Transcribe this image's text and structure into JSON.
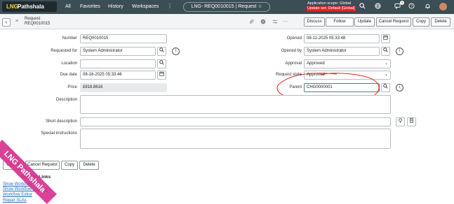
{
  "topnav": {
    "logo_lng": "LNG",
    "logo_text": "Pathshala",
    "links": [
      "All",
      "Favorites",
      "History",
      "Workspaces"
    ],
    "more": "⋮",
    "record_title": "LNG- REQ0010015 | Request ☆",
    "scope_line1": "Application scope: Global",
    "scope_line2": "Update set: Default [Global]",
    "notification_count": "1"
  },
  "form_header": {
    "back": "‹",
    "title_line1": "Request",
    "title_line2": "REQ0010015",
    "buttons": [
      "Discuss",
      "Follow",
      "Update",
      "Cancel Request",
      "Copy",
      "Delete"
    ]
  },
  "fields": {
    "number": {
      "label": "Number",
      "value": "REQ0010015"
    },
    "requested_for": {
      "label": "Requested for",
      "value": "System Administrator"
    },
    "location": {
      "label": "Location",
      "value": ""
    },
    "due_date": {
      "label": "Due date",
      "value": "08-16-2025 05:33:46"
    },
    "price": {
      "label": "Price",
      "value": "£818.8616"
    },
    "opened": {
      "label": "Opened",
      "value": "08-11-2025 05:33:48"
    },
    "opened_by": {
      "label": "Opened by",
      "value": "System Administrator"
    },
    "approval": {
      "label": "Approval",
      "value": "Approved"
    },
    "request_state": {
      "label": "Request state",
      "value": "Approved"
    },
    "parent": {
      "label": "Parent",
      "value": "CHG0000001"
    },
    "description": {
      "label": "Description"
    },
    "short_description": {
      "label": "Short description"
    },
    "special_instructions": {
      "label": "Special instructions"
    }
  },
  "bottom_buttons": [
    "Update",
    "Cancel Request",
    "Copy",
    "Delete"
  ],
  "related_links": {
    "header": "Related Links",
    "items": [
      "Show Workflow",
      "Show Workflow Context",
      "Workflow Editor",
      "Repair SLAs"
    ]
  },
  "watermark": "LNG Pathshala",
  "colors": {
    "nav_bg": "#3b4d55",
    "scope_alert": "#e0281f",
    "ribbon": "#d6338f",
    "annotation": "#e0281f"
  }
}
